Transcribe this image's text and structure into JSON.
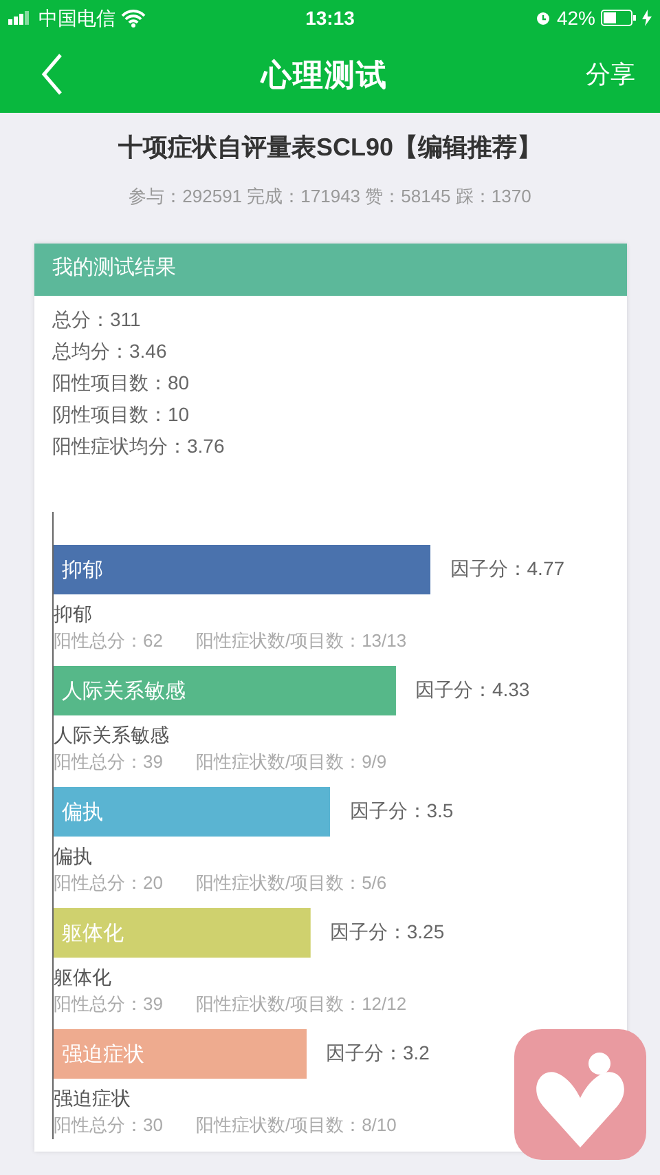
{
  "status_bar": {
    "carrier": "中国电信",
    "time": "13:13",
    "battery": "42%"
  },
  "nav": {
    "title": "心理测试",
    "action": "分享"
  },
  "test": {
    "title": "十项症状自评量表SCL90【编辑推荐】",
    "stats": "参与：292591 完成：171943 赞：58145 踩：1370"
  },
  "result": {
    "header": "我的测试结果",
    "summary": [
      "总分：311",
      "总均分：3.46",
      "阳性项目数：80",
      "阴性项目数：10",
      "阳性症状均分：3.76"
    ],
    "chart_data": {
      "type": "bar",
      "orientation": "horizontal",
      "categories": [
        "抑郁",
        "人际关系敏感",
        "偏执",
        "躯体化",
        "强迫症状"
      ],
      "values": [
        4.77,
        4.33,
        3.5,
        3.25,
        3.2
      ],
      "value_labels": [
        "因子分：4.77",
        "因子分：4.33",
        "因子分：3.5",
        "因子分：3.25",
        "因子分：3.2"
      ]
    },
    "factors": [
      {
        "color": "#4a72ad",
        "caption": "抑郁",
        "positive_total": "阳性总分：62",
        "ratio": "阳性症状数/项目数：13/13"
      },
      {
        "color": "#56b889",
        "caption": "人际关系敏感",
        "positive_total": "阳性总分：39",
        "ratio": "阳性症状数/项目数：9/9"
      },
      {
        "color": "#5ab4d2",
        "caption": "偏执",
        "positive_total": "阳性总分：20",
        "ratio": "阳性症状数/项目数：5/6"
      },
      {
        "color": "#cfd16e",
        "caption": "躯体化",
        "positive_total": "阳性总分：39",
        "ratio": "阳性症状数/项目数：12/12"
      },
      {
        "color": "#eeab8f",
        "caption": "强迫症状",
        "positive_total": "阳性总分：30",
        "ratio": "阳性症状数/项目数：8/10"
      }
    ]
  }
}
